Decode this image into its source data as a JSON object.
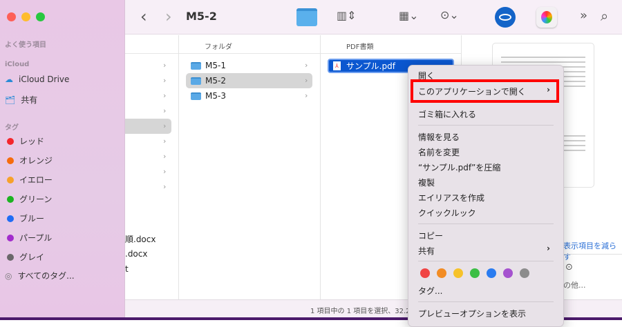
{
  "sidebar": {
    "favorites_label": "よく使う項目",
    "icloud_label": "iCloud",
    "icloud_drive": "iCloud Drive",
    "shared": "共有",
    "tags_label": "タグ",
    "tags": [
      {
        "label": "レッド",
        "color": "#f4262b"
      },
      {
        "label": "オレンジ",
        "color": "#f66c0c"
      },
      {
        "label": "イエロー",
        "color": "#f7a12a"
      },
      {
        "label": "グリーン",
        "color": "#1db322"
      },
      {
        "label": "ブルー",
        "color": "#1f6cf5"
      },
      {
        "label": "パープル",
        "color": "#a22ccc"
      },
      {
        "label": "グレイ",
        "color": "#6a676a"
      }
    ],
    "all_tags": "すべてのタグ..."
  },
  "toolbar": {
    "title": "M5-2",
    "back": "‹",
    "forward": "›",
    "more": "»",
    "search": "⌕"
  },
  "columns": {
    "col2_header": "フォルダ",
    "col3_header": "PDF書類",
    "folders": [
      "M5-1",
      "M5-2",
      "M5-3"
    ],
    "col1_files": [
      "順.docx",
      ".docx",
      "t"
    ],
    "selected_file": "サンプル.pdf"
  },
  "preview": {
    "show_less": "表示項目を減らす",
    "other": "の他..."
  },
  "status": {
    "text": "1 項目中の 1 項目を選択、32.2"
  },
  "context_menu": {
    "open": "開く",
    "open_with": "このアプリケーションで開く",
    "trash": "ゴミ箱に入れる",
    "get_info": "情報を見る",
    "rename": "名前を変更",
    "compress": "“サンプル.pdf”を圧縮",
    "duplicate": "複製",
    "alias": "エイリアスを作成",
    "quicklook": "クイックルック",
    "copy": "コピー",
    "share": "共有",
    "tag_colors": [
      "#f04444",
      "#f28c24",
      "#f6c22a",
      "#3cbe45",
      "#2a7cf0",
      "#a552cf",
      "#8c8c8c"
    ],
    "tags": "タグ...",
    "preview_options": "プレビューオプションを表示"
  }
}
